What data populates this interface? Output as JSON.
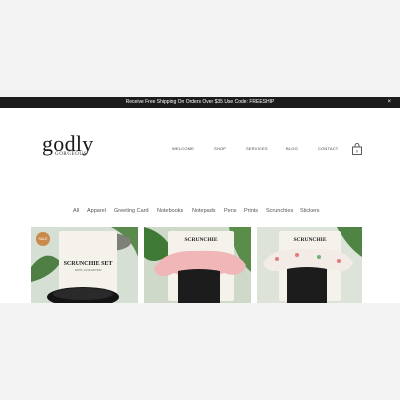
{
  "promo_bar": {
    "text": "Receive Free Shipping On Orders Over $35 Use Code: FREESHIP",
    "close_label": "×"
  },
  "logo": {
    "main": "godly",
    "sub": "GORGEOUS"
  },
  "nav": {
    "items": [
      "WELCOME",
      "SHOP",
      "SERVICES",
      "BLOG",
      "CONTACT"
    ],
    "cart_count": "0"
  },
  "filters": [
    "All",
    "Apparel",
    "Greeting Card",
    "Notebooks",
    "Notepads",
    "Pens",
    "Prints",
    "Scrunchies",
    "Stickers"
  ],
  "products": [
    {
      "badge": "SALE",
      "tag_title": "SCRUNCHIE SET",
      "tag_sub": "SATIN | LUXE EDITION"
    },
    {
      "tag_title": "SCRUNCHIE"
    },
    {
      "tag_title": "SCRUNCHIE"
    }
  ],
  "colors": {
    "promo_bg": "#1c1c1c",
    "page_bg": "#ffffff",
    "outer_bg": "#f3f3f3",
    "sale_badge": "#c98a4b"
  }
}
